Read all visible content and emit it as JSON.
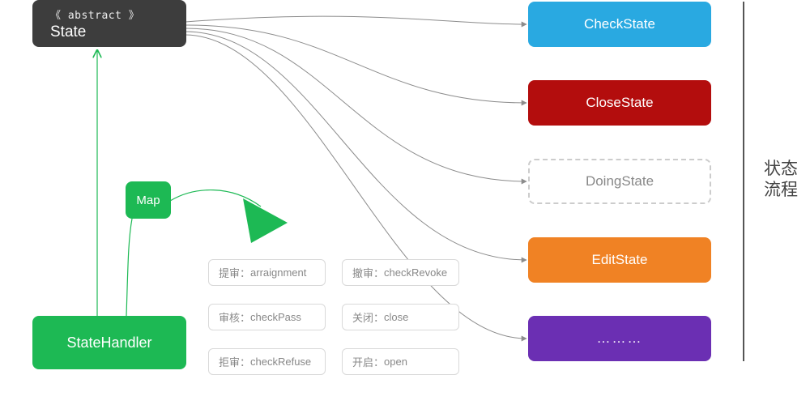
{
  "state": {
    "stereotype": "《 abstract 》",
    "name": "State"
  },
  "handler": {
    "name": "StateHandler"
  },
  "map": {
    "label": "Map"
  },
  "right_states": [
    {
      "id": "check",
      "label": "CheckState",
      "color": "#29a9e1"
    },
    {
      "id": "close",
      "label": "CloseState",
      "color": "#b30d0d"
    },
    {
      "id": "doing",
      "label": "DoingState",
      "color": "#ffffff"
    },
    {
      "id": "edit",
      "label": "EditState",
      "color": "#f08224"
    },
    {
      "id": "more",
      "label": "………",
      "color": "#6b2fb3"
    }
  ],
  "methods_left": [
    {
      "zh": "提审：",
      "en": "arraignment"
    },
    {
      "zh": "审核：",
      "en": "checkPass"
    },
    {
      "zh": "拒审：",
      "en": "checkRefuse"
    }
  ],
  "methods_right": [
    {
      "zh": "撤审：",
      "en": "checkRevoke"
    },
    {
      "zh": "关闭：",
      "en": "close"
    },
    {
      "zh": "开启：",
      "en": "open"
    }
  ],
  "side_label": {
    "line1": "状态",
    "line2": "流程"
  }
}
